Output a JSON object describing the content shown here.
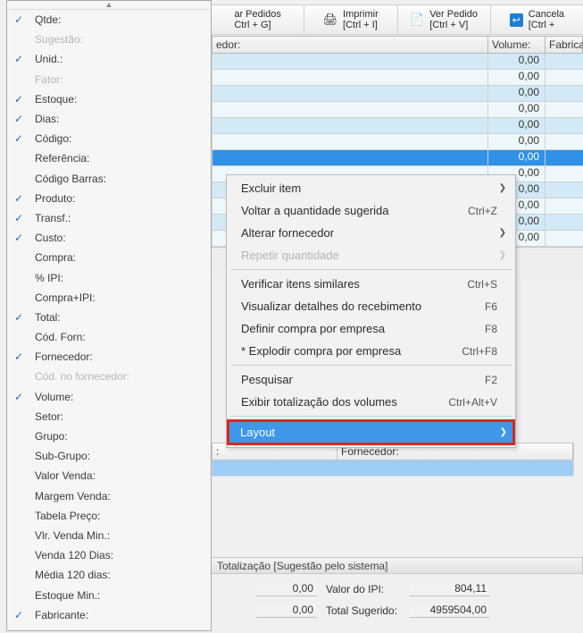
{
  "toolbar": {
    "pedidos": {
      "line1": "ar Pedidos",
      "line2": "Ctrl + G]"
    },
    "imprimir": {
      "line1": "Imprimir",
      "line2": "[Ctrl + I]"
    },
    "ver": {
      "line1": "Ver Pedido",
      "line2": "[Ctrl + V]"
    },
    "cancelar": {
      "line1": "Cancela",
      "line2": "[Ctrl + "
    }
  },
  "grid_head": {
    "fornecedor": "edor:",
    "volume": "Volume:",
    "fabricante": "Fabrican"
  },
  "grid_rows": [
    {
      "volume": "0,00",
      "sel": false,
      "z": "a"
    },
    {
      "volume": "0,00",
      "sel": false,
      "z": "b"
    },
    {
      "volume": "0,00",
      "sel": false,
      "z": "a"
    },
    {
      "volume": "0,00",
      "sel": false,
      "z": "b"
    },
    {
      "volume": "0,00",
      "sel": false,
      "z": "a"
    },
    {
      "volume": "0,00",
      "sel": false,
      "z": "b"
    },
    {
      "volume": "0,00",
      "sel": true,
      "z": "a"
    },
    {
      "volume": "0,00",
      "sel": false,
      "z": "b"
    },
    {
      "volume": "0,00",
      "sel": false,
      "z": "a"
    },
    {
      "volume": "0,00",
      "sel": false,
      "z": "b"
    },
    {
      "volume": "0,00",
      "sel": false,
      "z": "a"
    },
    {
      "volume": "0,00",
      "sel": false,
      "z": "b"
    }
  ],
  "fields": [
    {
      "label": "Qtde:",
      "checked": true
    },
    {
      "label": "Sugestão:",
      "checked": false,
      "dim": true
    },
    {
      "label": "Unid.:",
      "checked": true
    },
    {
      "label": "Fator:",
      "checked": false,
      "dim": true
    },
    {
      "label": "Estoque:",
      "checked": true
    },
    {
      "label": "Dias:",
      "checked": true
    },
    {
      "label": "Código:",
      "checked": true
    },
    {
      "label": "Referência:",
      "checked": false
    },
    {
      "label": "Código Barras:",
      "checked": false
    },
    {
      "label": "Produto:",
      "checked": true
    },
    {
      "label": "Transf.:",
      "checked": true
    },
    {
      "label": "Custo:",
      "checked": true
    },
    {
      "label": "Compra:",
      "checked": false
    },
    {
      "label": "% IPI:",
      "checked": false
    },
    {
      "label": "Compra+IPI:",
      "checked": false
    },
    {
      "label": "Total:",
      "checked": true
    },
    {
      "label": "Cód. Forn:",
      "checked": false
    },
    {
      "label": "Fornecedor:",
      "checked": true
    },
    {
      "label": "Cód. no fornecedor:",
      "checked": false,
      "dim": true
    },
    {
      "label": "Volume:",
      "checked": true
    },
    {
      "label": "Setor:",
      "checked": false
    },
    {
      "label": "Grupo:",
      "checked": false
    },
    {
      "label": "Sub-Grupo:",
      "checked": false
    },
    {
      "label": "Valor Venda:",
      "checked": false
    },
    {
      "label": "Margem Venda:",
      "checked": false
    },
    {
      "label": "Tabela Preço:",
      "checked": false
    },
    {
      "label": "Vlr. Venda Min.:",
      "checked": false
    },
    {
      "label": "Venda 120 Dias:",
      "checked": false
    },
    {
      "label": "Média 120 dias:",
      "checked": false
    },
    {
      "label": "Estoque Min.:",
      "checked": false
    },
    {
      "label": "Fabricante:",
      "checked": true
    }
  ],
  "ctx_menu": [
    {
      "label": "Excluir item",
      "shortcut": "",
      "sub": true
    },
    {
      "label": "Voltar a quantidade sugerida",
      "shortcut": "Ctrl+Z"
    },
    {
      "label": "Alterar fornecedor",
      "shortcut": "",
      "sub": true
    },
    {
      "label": "Repetir quantidade",
      "shortcut": "",
      "sub": true,
      "disabled": true
    },
    {
      "sep": true
    },
    {
      "label": "Verificar itens similares",
      "shortcut": "Ctrl+S"
    },
    {
      "label": "Visualizar detalhes do recebimento",
      "shortcut": "F6"
    },
    {
      "label": "Definir compra por empresa",
      "shortcut": "F8"
    },
    {
      "label": "* Explodir compra por empresa",
      "shortcut": "Ctrl+F8"
    },
    {
      "sep": true
    },
    {
      "label": "Pesquisar",
      "shortcut": "F2"
    },
    {
      "label": "Exibir totalização dos volumes",
      "shortcut": "Ctrl+Alt+V"
    },
    {
      "sep": true
    },
    {
      "label": "Layout",
      "shortcut": "",
      "sub": true,
      "highlight": true
    }
  ],
  "lower_table": {
    "col_blank": ":",
    "col_fornecedor": "Fornecedor:"
  },
  "totals": {
    "title": "Totalização [Sugestão pelo sistema]",
    "rows": [
      {
        "v1": "0,00",
        "label": "Valor do IPI:",
        "v2": "804,11"
      },
      {
        "v1": "0,00",
        "label": "Total Sugerido:",
        "v2": "4959504,00"
      }
    ]
  }
}
